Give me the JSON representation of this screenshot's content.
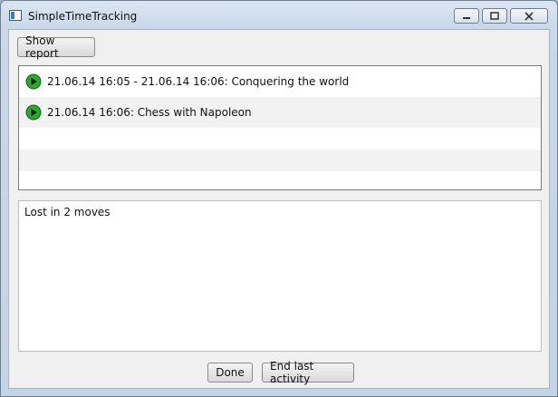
{
  "window": {
    "title": "SimpleTimeTracking"
  },
  "caption_buttons": {
    "minimize": "▭",
    "restore": "⧉",
    "close": "✕"
  },
  "toolbar": {
    "show_report_label": "Show report"
  },
  "activities": [
    {
      "icon": "play-icon",
      "text": "21.06.14 16:05 - 21.06.14 16:06: Conquering the world"
    },
    {
      "icon": "play-icon",
      "text": "21.06.14 16:06: Chess with Napoleon"
    }
  ],
  "notes": {
    "value": "Lost in 2 moves"
  },
  "actions": {
    "done_label": "Done",
    "end_last_label": "End last activity"
  },
  "colors": {
    "play_green": "#2e9e2e",
    "play_dark": "#1e6b1e"
  }
}
